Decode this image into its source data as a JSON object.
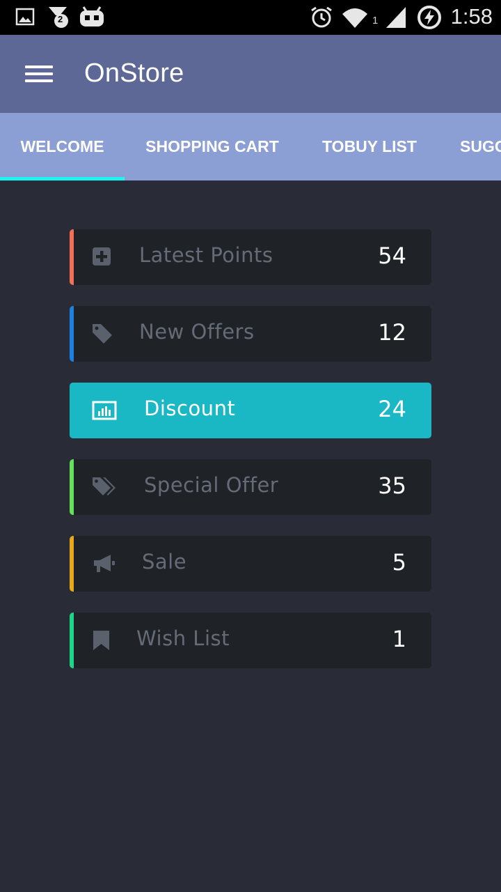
{
  "status_bar": {
    "time": "1:58",
    "notification_badge": "2",
    "signal_sub": "1",
    "icons": [
      "image-icon",
      "download-badge-icon",
      "robot-icon",
      "alarm-icon",
      "wifi-icon",
      "signal-icon",
      "battery-charging-icon"
    ]
  },
  "app_bar": {
    "title": "OnStore",
    "menu_icon": "hamburger-menu-icon"
  },
  "tabs": [
    {
      "label": "WELCOME",
      "selected": true
    },
    {
      "label": "SHOPPING CART",
      "selected": false
    },
    {
      "label": "TOBUY LIST",
      "selected": false
    },
    {
      "label": "SUGG",
      "selected": false
    }
  ],
  "colors": {
    "status_bar": "#000000",
    "app_bar": "#5e6896",
    "tab_bar": "#8c9fd4",
    "tab_indicator": "#1ff5f0",
    "background": "#292b36",
    "card": "#1f2227",
    "card_active": "#19b8c4"
  },
  "cards": [
    {
      "label": "Latest Points",
      "count": "54",
      "icon": "plus-square-icon",
      "accent": "#f26f5a",
      "active": false
    },
    {
      "label": "New Offers",
      "count": "12",
      "icon": "tag-icon",
      "accent": "#1e7fe0",
      "active": false
    },
    {
      "label": "Discount",
      "count": "24",
      "icon": "bar-chart-icon",
      "accent": "#19b8c4",
      "active": true
    },
    {
      "label": "Special Offer",
      "count": "35",
      "icon": "tags-icon",
      "accent": "#66e05a",
      "active": false
    },
    {
      "label": "Sale",
      "count": "5",
      "icon": "megaphone-icon",
      "accent": "#e8a81c",
      "active": false
    },
    {
      "label": "Wish List",
      "count": "1",
      "icon": "bookmark-icon",
      "accent": "#1ed68a",
      "active": false
    }
  ]
}
